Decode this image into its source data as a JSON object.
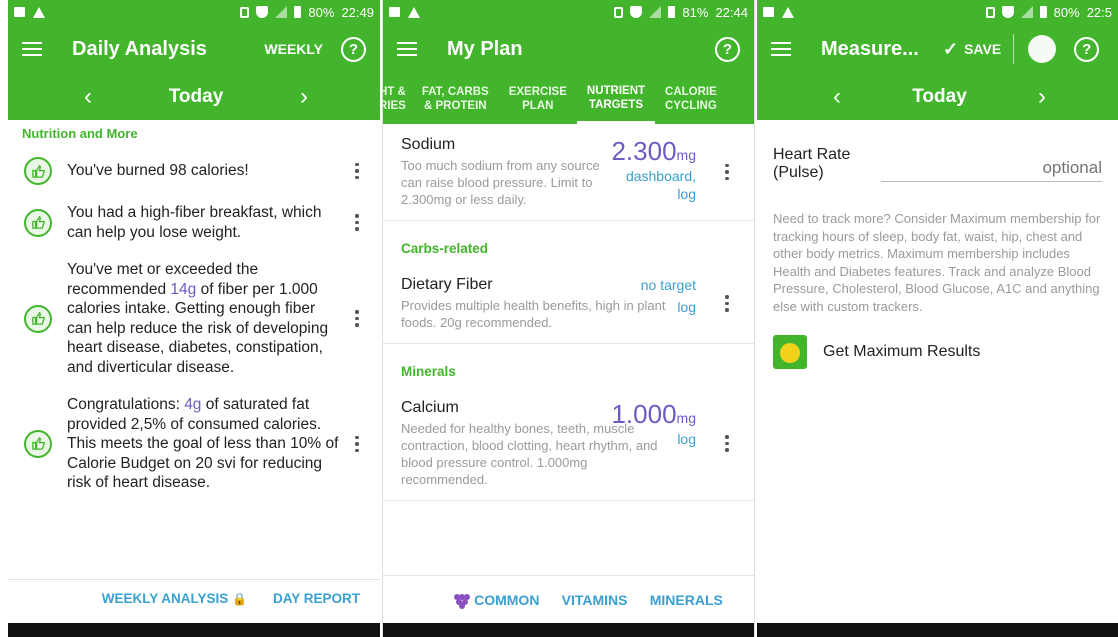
{
  "colors": {
    "brand_green": "#43b52d",
    "link_blue": "#3a9fd1",
    "value_purple": "#6b5cc1"
  },
  "screen1": {
    "status": {
      "battery": "80%",
      "time": "22:49"
    },
    "title": "Daily Analysis",
    "action": "WEEKLY",
    "help_icon": "?",
    "date": {
      "prev": "‹",
      "label": "Today",
      "next": "›"
    },
    "section": "Nutrition and More",
    "items": [
      {
        "text": "You've burned 98 calories!"
      },
      {
        "text": "You had a high-fiber breakfast, which can help you lose weight."
      },
      {
        "pre": "You've met or exceeded the recommended ",
        "hl": "14g",
        "post": " of fiber per 1.000 calories intake. Getting enough fiber can help reduce the risk of developing heart disease, diabetes, constipation, and diverticular disease."
      },
      {
        "pre": "Congratulations: ",
        "hl": "4g",
        "post": " of saturated fat provided 2,5% of consumed calories. This meets the goal of less than 10% of Calorie Budget on 20 svi for reducing risk of heart disease."
      }
    ],
    "bottom": {
      "weekly": "WEEKLY ANALYSIS",
      "lock": "🔒",
      "day": "DAY REPORT"
    }
  },
  "screen2": {
    "status": {
      "battery": "81%",
      "time": "22:44"
    },
    "title": "My Plan",
    "help_icon": "?",
    "tabs": [
      {
        "l1": "HT &",
        "l2": "RIES"
      },
      {
        "l1": "FAT, CARBS",
        "l2": "& PROTEIN"
      },
      {
        "l1": "EXERCISE",
        "l2": "PLAN"
      },
      {
        "l1": "NUTRIENT",
        "l2": "TARGETS",
        "active": true
      },
      {
        "l1": "CALORIE",
        "l2": "CYCLING"
      }
    ],
    "sodium": {
      "name": "Sodium",
      "desc": "Too much sodium from any source can raise blood pressure. Limit to 2.300mg or less daily.",
      "value": "2.300",
      "unit": "mg",
      "link": "dashboard, log"
    },
    "carbs_heading": "Carbs-related",
    "fiber": {
      "name": "Dietary Fiber",
      "desc": "Provides multiple health benefits, high in plant foods. 20g recommended.",
      "target": "no target",
      "link": "log"
    },
    "minerals_heading": "Minerals",
    "calcium": {
      "name": "Calcium",
      "desc": "Needed for healthy bones, teeth, muscle contraction, blood clotting, heart rhythm, and blood pressure control. 1.000mg recommended.",
      "value": "1.000",
      "unit": "mg",
      "link": "log"
    },
    "bottom_tabs": {
      "common": "COMMON",
      "vitamins": "VITAMINS",
      "minerals": "MINERALS"
    }
  },
  "screen3": {
    "status": {
      "battery": "80%",
      "time": "22:5"
    },
    "title": "Measure...",
    "save": "SAVE",
    "date": {
      "prev": "‹",
      "label": "Today",
      "next": "›"
    },
    "heart_rate": {
      "label": "Heart Rate (Pulse)",
      "placeholder": "optional"
    },
    "promo": "Need to track more? Consider Maximum membership for tracking hours of sleep, body fat, waist, hip, chest and other body metrics. Maximum membership includes Health and Diabetes features. Track and analyze Blood Pressure, Cholesterol, Blood Glucose, A1C and anything else with custom trackers.",
    "max_results": "Get Maximum Results"
  }
}
